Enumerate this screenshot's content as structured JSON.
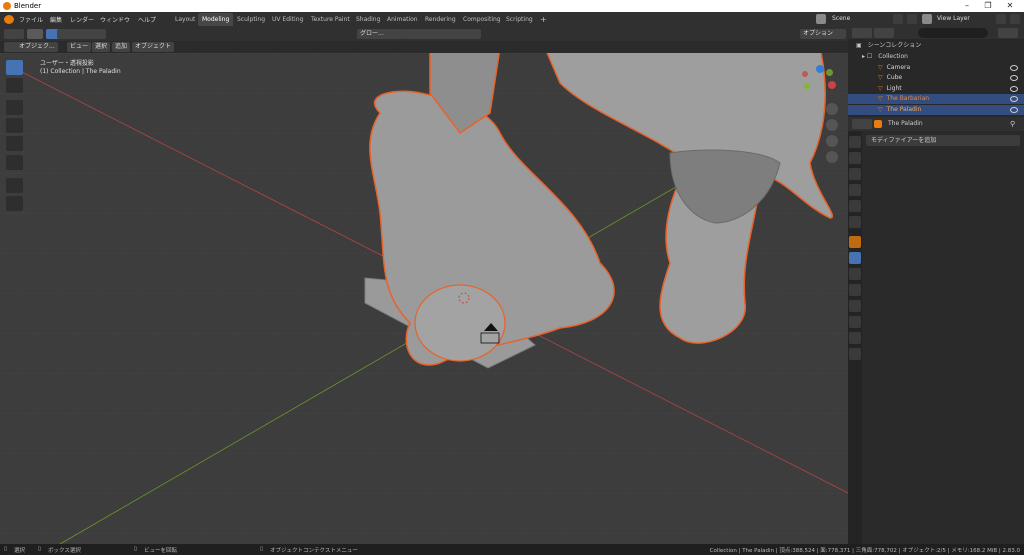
{
  "titlebar": {
    "title": "Blender"
  },
  "menubar": {
    "menus": [
      "ファイル",
      "編集",
      "レンダー",
      "ウィンドウ",
      "ヘルプ"
    ],
    "workspaces": [
      "Layout",
      "Modeling",
      "Sculpting",
      "UV Editing",
      "Texture Paint",
      "Shading",
      "Animation",
      "Rendering",
      "Compositing",
      "Scripting"
    ],
    "active_workspace": "Modeling",
    "add_tab": "+",
    "scene": "Scene",
    "view_layer": "View Layer"
  },
  "viewport_header": {
    "mode": "オブジェク...",
    "menus": [
      "ビュー",
      "選択",
      "追加",
      "オブジェクト"
    ],
    "transform": "グロー...",
    "options": "オプション"
  },
  "viewport": {
    "view_name": "ユーザー・透視投影",
    "context": "(1) Collection | The Paladin"
  },
  "outliner": {
    "root": "シーンコレクション",
    "collection": "Collection",
    "items": [
      {
        "name": "Camera",
        "color": "#d8d8d8",
        "selected": false
      },
      {
        "name": "Cube",
        "color": "#d8d8d8",
        "selected": false
      },
      {
        "name": "Light",
        "color": "#d8d8d8",
        "selected": false
      },
      {
        "name": "The Barbarian",
        "color": "#e8883a",
        "selected": true
      },
      {
        "name": "The Paladin",
        "color": "#f0a860",
        "selected": true
      }
    ]
  },
  "properties": {
    "object_name": "The Paladin",
    "add_modifier": "モディファイアーを追加"
  },
  "statusbar": {
    "select": "選択",
    "box_select": "ボックス選択",
    "rotate_view": "ビューを回転",
    "context_menu": "オブジェクトコンテクストメニュー",
    "stats": "Collection | The Paladin | 頂点:388,524 | 面:778,371 | 三角面:778,702 | オブジェクト:2/5 | メモリ:168.2 MiB | 2.83.0"
  },
  "colors": {
    "accent": "#4772b3",
    "selection_outline": "#e8622a",
    "x_axis": "#b04545",
    "y_axis": "#6b9a2b"
  }
}
